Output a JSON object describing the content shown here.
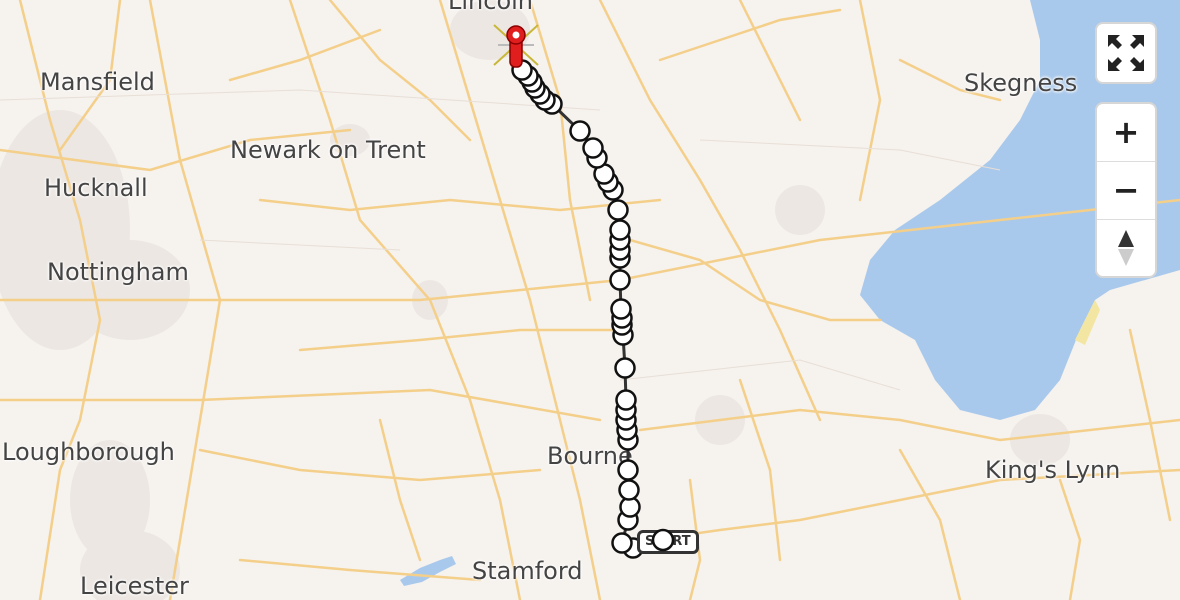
{
  "map": {
    "cities": [
      {
        "id": "lincoln",
        "name": "Lincoln"
      },
      {
        "id": "mansfield",
        "name": "Mansfield"
      },
      {
        "id": "skegness",
        "name": "Skegness"
      },
      {
        "id": "newark",
        "name": "Newark on Trent"
      },
      {
        "id": "hucknall",
        "name": "Hucknall"
      },
      {
        "id": "nottingham",
        "name": "Nottingham"
      },
      {
        "id": "loughborough",
        "name": "Loughborough"
      },
      {
        "id": "bourne",
        "name": "Bourne"
      },
      {
        "id": "kings-lynn",
        "name": "King's Lynn"
      },
      {
        "id": "stamford",
        "name": "Stamford"
      },
      {
        "id": "leicester",
        "name": "Leicester"
      }
    ],
    "route": {
      "color": "#333333",
      "start_label": "START",
      "end_marker_color": "#e01e1e"
    }
  },
  "controls": {
    "fullscreen": "fullscreen-icon",
    "zoom_in": "+",
    "zoom_out": "−",
    "reset_north": "compass-icon"
  }
}
